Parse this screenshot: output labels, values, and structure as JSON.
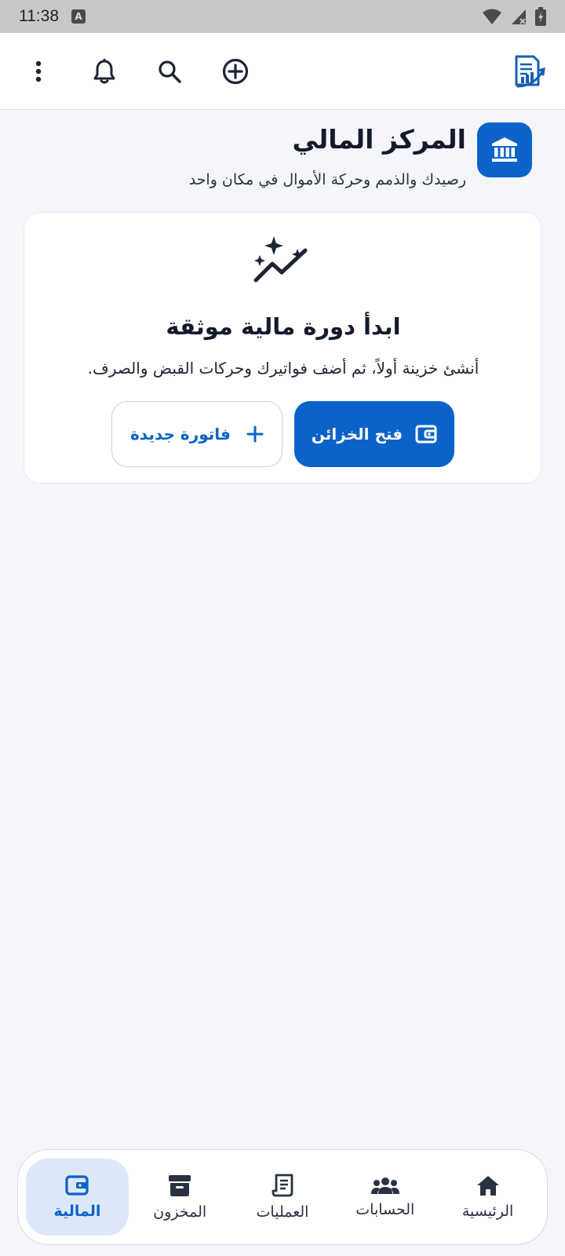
{
  "status_bar": {
    "time": "11:38",
    "notification_letter": "A"
  },
  "app_bar": {
    "icons": [
      "more-vertical-icon",
      "bell-icon",
      "search-icon",
      "add-circle-icon",
      "app-logo-icon"
    ]
  },
  "header": {
    "title": "المركز المالي",
    "subtitle": "رصيدك والذمم وحركة الأموال في مكان واحد",
    "icon": "bank-icon"
  },
  "empty_state": {
    "icon": "sparkles-trend-icon",
    "title": "ابدأ دورة مالية موثقة",
    "description": "أنشئ خزينة أولاً، ثم أضف فواتيرك وحركات القبض والصرف.",
    "primary_button": {
      "label": "فتح الخزائن",
      "icon": "wallet-icon"
    },
    "secondary_button": {
      "label": "فاتورة جديدة",
      "icon": "plus-icon"
    }
  },
  "bottom_nav": {
    "items": [
      {
        "label": "الرئيسية",
        "icon": "home-icon",
        "active": false
      },
      {
        "label": "الحسابات",
        "icon": "people-icon",
        "active": false
      },
      {
        "label": "العمليات",
        "icon": "receipt-icon",
        "active": false
      },
      {
        "label": "المخزون",
        "icon": "archive-box-icon",
        "active": false
      },
      {
        "label": "المالية",
        "icon": "wallet-icon",
        "active": true
      }
    ]
  },
  "colors": {
    "primary": "#0b63c9",
    "background": "#f4f6fb",
    "surface": "#ffffff",
    "active_nav_bg": "#dce8f7"
  }
}
